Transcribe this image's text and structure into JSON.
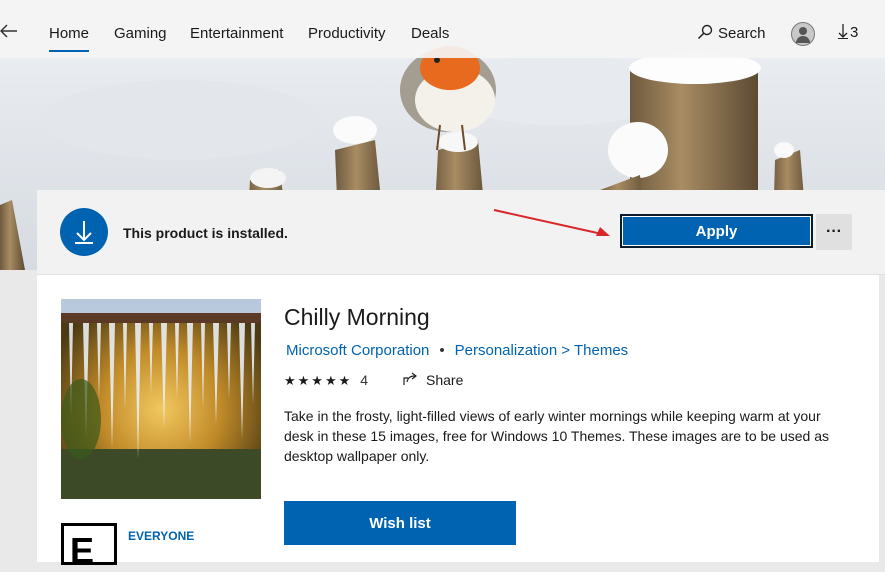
{
  "nav": {
    "back_icon": "back-arrow-icon",
    "tabs": [
      {
        "label": "Home",
        "active": true
      },
      {
        "label": "Gaming",
        "active": false
      },
      {
        "label": "Entertainment",
        "active": false
      },
      {
        "label": "Productivity",
        "active": false
      },
      {
        "label": "Deals",
        "active": false
      }
    ],
    "search_label": "Search",
    "downloads_count": "3"
  },
  "banner": {
    "status_text": "This product is installed.",
    "apply_label": "Apply",
    "more_label": "···"
  },
  "product": {
    "title": "Chilly Morning",
    "publisher": "Microsoft Corporation",
    "category": "Personalization",
    "subcategory": "Themes",
    "separator": ">",
    "stars": "★★★★★",
    "rating_count": "4",
    "share_label": "Share",
    "description": "Take in the frosty, light-filled views of early winter mornings while keeping warm at your desk in these 15 images, free for Windows 10 Themes. These images are to be used as desktop wallpaper only.",
    "wishlist_label": "Wish list",
    "age_rating_letter": "E",
    "age_rating_label": "EVERYONE"
  },
  "colors": {
    "accent": "#0063b1",
    "annotation_arrow": "#d9262b"
  }
}
